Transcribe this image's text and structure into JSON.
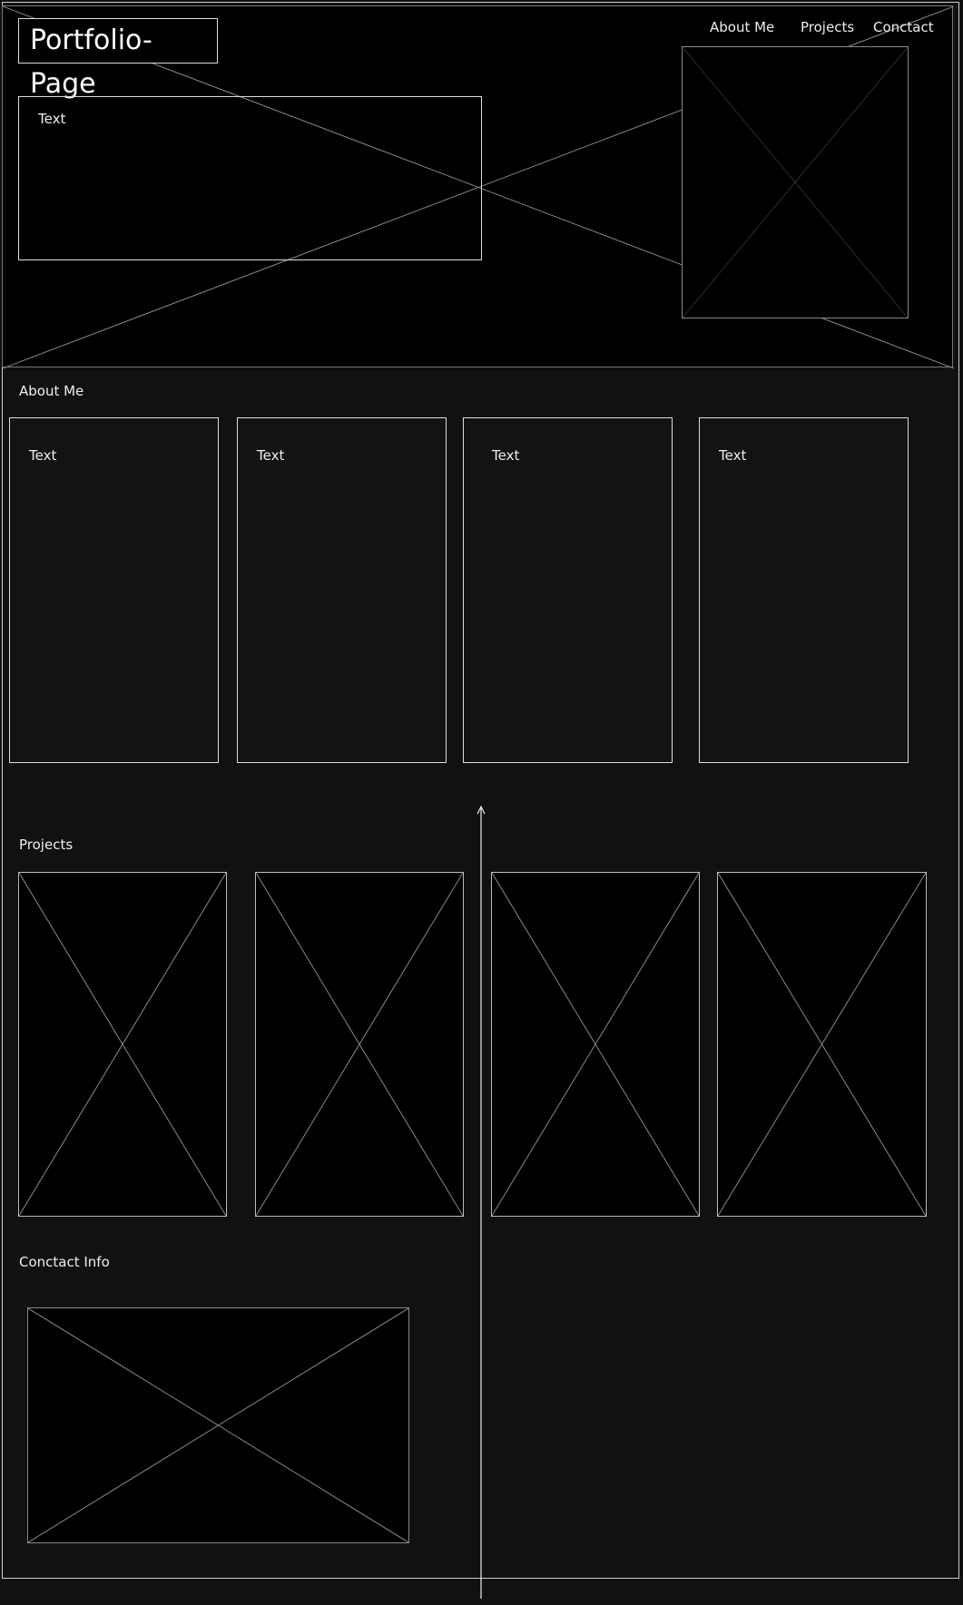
{
  "header": {
    "title": "Portfolio-Page",
    "nav": [
      {
        "label": "About Me"
      },
      {
        "label": "Projects"
      },
      {
        "label": "Conctact"
      }
    ],
    "hero_text": "Text"
  },
  "about": {
    "heading": "About Me",
    "cards": [
      {
        "text": "Text"
      },
      {
        "text": "Text"
      },
      {
        "text": "Text"
      },
      {
        "text": "Text"
      }
    ]
  },
  "projects": {
    "heading": "Projects"
  },
  "contact": {
    "heading": "Conctact Info"
  },
  "colors": {
    "background": "#111111",
    "panel": "#000000",
    "stroke": "#dddddd"
  }
}
